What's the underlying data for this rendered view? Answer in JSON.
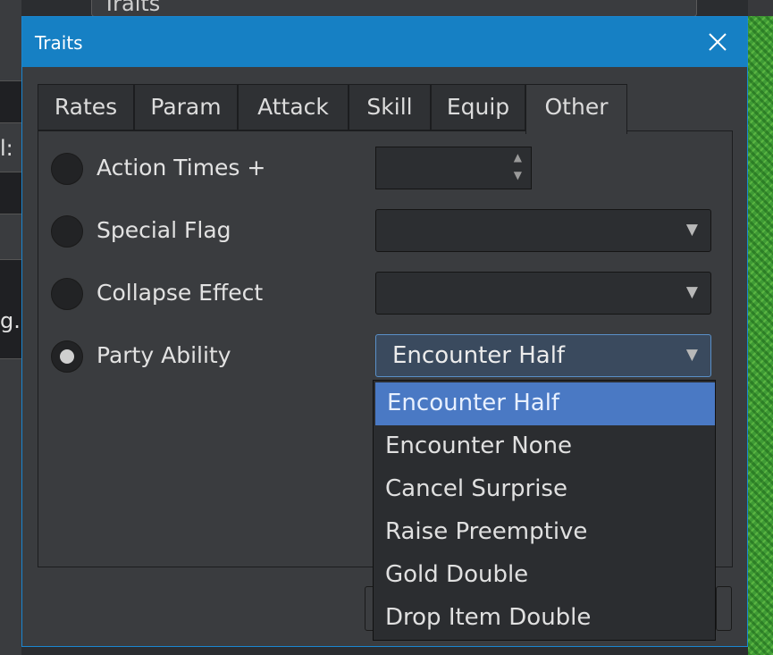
{
  "background": {
    "left_labels": [
      "l:",
      "g."
    ],
    "top_panel_title": "Traits"
  },
  "dialog": {
    "title": "Traits",
    "close_icon": "close-icon"
  },
  "tabs": [
    {
      "label": "Rates",
      "active": false
    },
    {
      "label": "Param",
      "active": false
    },
    {
      "label": "Attack",
      "active": false
    },
    {
      "label": "Skill",
      "active": false
    },
    {
      "label": "Equip",
      "active": false
    },
    {
      "label": "Other",
      "active": true
    }
  ],
  "options": {
    "action_times": {
      "label": "Action Times +",
      "selected": false,
      "value": ""
    },
    "special_flag": {
      "label": "Special Flag",
      "selected": false,
      "value": ""
    },
    "collapse_effect": {
      "label": "Collapse Effect",
      "selected": false,
      "value": ""
    },
    "party_ability": {
      "label": "Party Ability",
      "selected": true,
      "value": "Encounter Half"
    }
  },
  "dropdown": {
    "items": [
      "Encounter Half",
      "Encounter None",
      "Cancel Surprise",
      "Raise Preemptive",
      "Gold Double",
      "Drop Item Double"
    ],
    "highlighted": "Encounter Half"
  },
  "colors": {
    "titlebar": "#1680c4",
    "highlight": "#4a79c4",
    "dialog_bg": "#3a3c3f"
  }
}
